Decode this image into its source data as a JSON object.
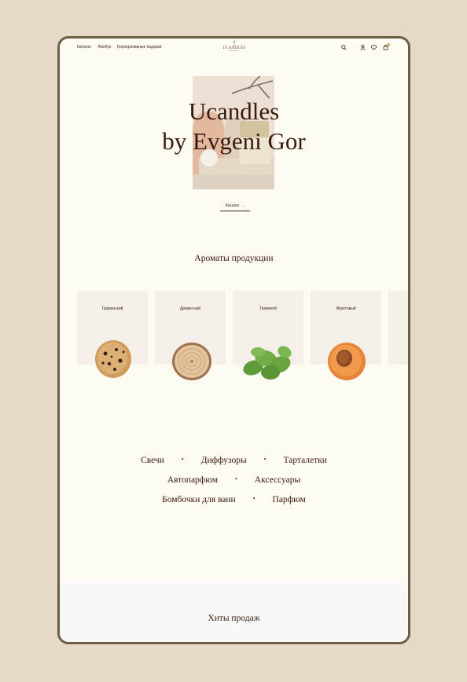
{
  "header": {
    "nav": [
      "Каталог",
      "Люкбук",
      "Корпоративные подарки"
    ],
    "logo_text": "UCANDLES",
    "logo_tagline": "by Evgeni Gor",
    "cart_count": "0"
  },
  "hero": {
    "title_line1": "Ucandles",
    "title_line2": "by Evgeni Gor",
    "button_label": "Каталог"
  },
  "aromas": {
    "title": "Ароматы продукции",
    "items": [
      {
        "label": "Гурманский"
      },
      {
        "label": "Древесный"
      },
      {
        "label": "Травяной"
      },
      {
        "label": "Фруктовый"
      }
    ]
  },
  "categories": {
    "rows": [
      [
        "Свечи",
        "Диффузоры",
        "Тарталетки"
      ],
      [
        "Автопарфюм",
        "Аксессуары"
      ],
      [
        "Бомбочки для ванн",
        "Парфюм"
      ]
    ]
  },
  "hits": {
    "title": "Хиты продаж"
  },
  "colors": {
    "page_bg": "#e6d9c7",
    "frame_border": "#6b5e44",
    "content_bg": "#fefbf3",
    "text_dark": "#3a1a0e"
  }
}
